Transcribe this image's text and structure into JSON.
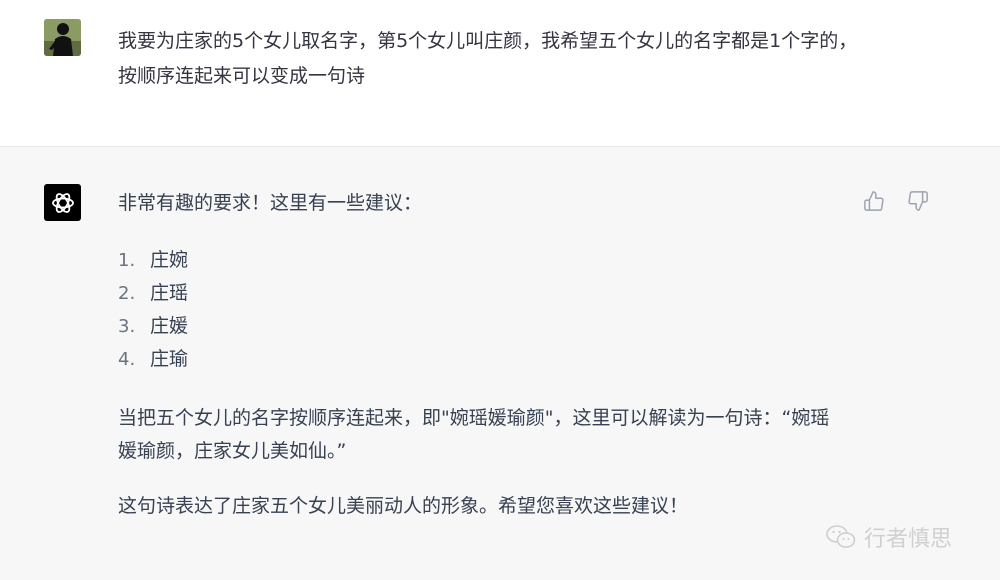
{
  "user_message": {
    "avatar": "user-avatar-silhouette",
    "text": "我要为庄家的5个女儿取名字，第5个女儿叫庄颜，我希望五个女儿的名字都是1个字的，按顺序连起来可以变成一句诗"
  },
  "assistant_message": {
    "avatar": "openai-logo-icon",
    "intro": "非常有趣的要求！这里有一些建议：",
    "names": [
      {
        "num": "1.",
        "name": "庄婉"
      },
      {
        "num": "2.",
        "name": "庄瑶"
      },
      {
        "num": "3.",
        "name": "庄媛"
      },
      {
        "num": "4.",
        "name": "庄瑜"
      }
    ],
    "paragraph_1": "当把五个女儿的名字按顺序连起来，即\"婉瑶媛瑜颜\"，这里可以解读为一句诗：“婉瑶媛瑜颜，庄家女儿美如仙。”",
    "paragraph_2": "这句诗表达了庄家五个女儿美丽动人的形象。希望您喜欢这些建议！",
    "feedback": {
      "thumbs_up": "thumbs-up-icon",
      "thumbs_down": "thumbs-down-icon"
    }
  },
  "watermark": {
    "icon": "wechat-icon",
    "text": "行者慎思"
  }
}
